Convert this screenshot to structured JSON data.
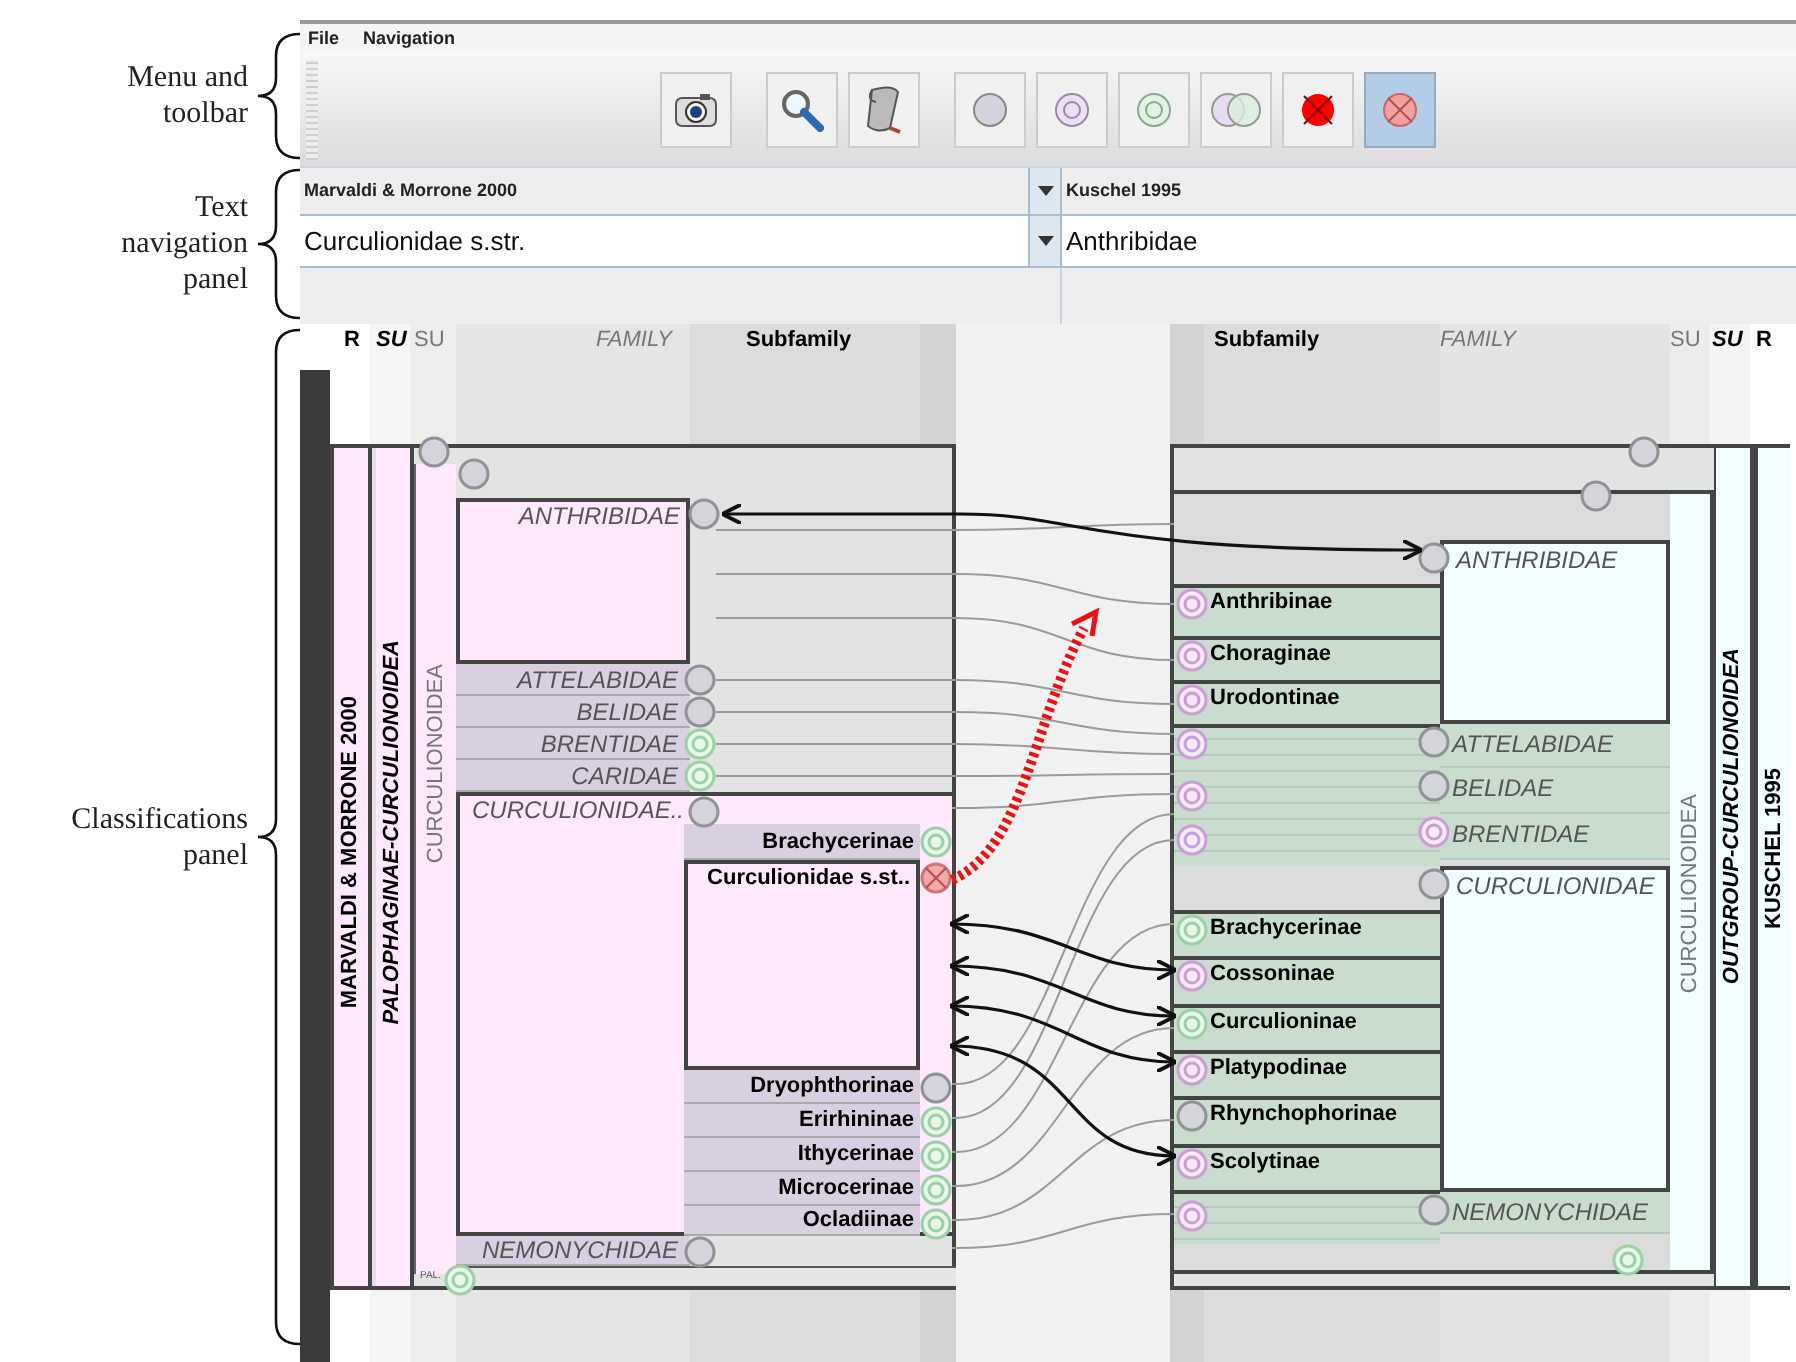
{
  "annotations": [
    {
      "lines": [
        "Menu and",
        "toolbar"
      ]
    },
    {
      "lines": [
        "Text",
        "navigation",
        "panel"
      ]
    },
    {
      "lines": [
        "Classifications",
        "panel"
      ]
    }
  ],
  "menu": [
    "File",
    "Navigation"
  ],
  "toolbar": [
    {
      "kind": "camera",
      "selected": false
    },
    {
      "kind": "magnifier",
      "selected": false
    },
    {
      "kind": "scroll",
      "selected": false
    },
    {
      "kind": "circle",
      "selected": false
    },
    {
      "kind": "lilac-ring",
      "selected": false
    },
    {
      "kind": "mint-ring",
      "selected": false
    },
    {
      "kind": "overlap",
      "selected": false
    },
    {
      "kind": "red-cross",
      "selected": false
    },
    {
      "kind": "pink-cross",
      "selected": true
    }
  ],
  "text_navigation": {
    "left": {
      "classification": "Marvaldi & Morrone 2000",
      "taxon": "Curculionidae s.str."
    },
    "right": {
      "classification": "Kuschel 1995",
      "taxon": "Anthribidae"
    }
  },
  "classifications": {
    "header_left": [
      {
        "text": "R",
        "kind": "bold"
      },
      {
        "text": "SU",
        "kind": "emphasis"
      },
      {
        "text": "SU",
        "kind": "plain"
      },
      {
        "text": "FAMILY",
        "kind": "italic"
      },
      {
        "text": "Subfamily",
        "kind": "bold"
      }
    ],
    "header_right": [
      {
        "text": "Subfamily",
        "kind": "bold"
      },
      {
        "text": "FAMILY",
        "kind": "italic"
      },
      {
        "text": "SU",
        "kind": "plain"
      },
      {
        "text": "SU",
        "kind": "emphasis"
      },
      {
        "text": "R",
        "kind": "bold"
      }
    ],
    "left": {
      "title": "MARVALDI & MORRONE 2000",
      "superorder": "PALOPHAGINAE-CURCULIONOIDEA",
      "superfamily": "CURCULIONOIDEA",
      "footer": "PAL.",
      "families": [
        {
          "name": "ANTHRIBIDAE",
          "kind": "plain",
          "expanded": true
        },
        {
          "name": "ATTELABIDAE",
          "kind": "plain",
          "expanded": false
        },
        {
          "name": "BELIDAE",
          "kind": "plain",
          "expanded": false
        },
        {
          "name": "BRENTIDAE",
          "kind": "mint",
          "expanded": false
        },
        {
          "name": "CARIDAE",
          "kind": "mint",
          "expanded": false
        },
        {
          "name": "CURCULIONIDAE..",
          "kind": "plain",
          "expanded": true,
          "children": [
            {
              "name": "Brachycerinae",
              "kind": "mint",
              "expanded": false
            },
            {
              "name": "Curculionidae s.st..",
              "kind": "cross",
              "expanded": true
            },
            {
              "name": "Dryophthorinae",
              "kind": "plain",
              "expanded": false
            },
            {
              "name": "Erirhininae",
              "kind": "mint",
              "expanded": false
            },
            {
              "name": "Ithycerinae",
              "kind": "mint",
              "expanded": false
            },
            {
              "name": "Microcerinae",
              "kind": "mint",
              "expanded": false
            },
            {
              "name": "Ocladiinae",
              "kind": "mint",
              "expanded": false
            }
          ]
        },
        {
          "name": "NEMONYCHIDAE",
          "kind": "plain",
          "expanded": false
        }
      ]
    },
    "right": {
      "title": "KUSCHEL 1995",
      "superorder": "OUTGROUP-CURCULIONOIDEA",
      "superfamily": "CURCULIONOIDEA",
      "families": [
        {
          "name": "ANTHRIBIDAE",
          "kind": "plain",
          "expanded": true,
          "children": [
            {
              "name": "Anthribinae",
              "kind": "lilac"
            },
            {
              "name": "Choraginae",
              "kind": "lilac"
            },
            {
              "name": "Urodontinae",
              "kind": "lilac"
            }
          ]
        },
        {
          "name": "ATTELABIDAE",
          "kind": "plain",
          "expanded": false
        },
        {
          "name": "BELIDAE",
          "kind": "plain",
          "expanded": false
        },
        {
          "name": "BRENTIDAE",
          "kind": "lilac",
          "expanded": false
        },
        {
          "name": "CURCULIONIDAE",
          "kind": "plain",
          "expanded": true,
          "children": [
            {
              "name": "Brachycerinae",
              "kind": "mint"
            },
            {
              "name": "Cossoninae",
              "kind": "lilac"
            },
            {
              "name": "Curculioninae",
              "kind": "mint"
            },
            {
              "name": "Platypodinae",
              "kind": "lilac"
            },
            {
              "name": "Rhynchophorinae",
              "kind": "plain"
            },
            {
              "name": "Scolytinae",
              "kind": "lilac"
            }
          ]
        },
        {
          "name": "NEMONYCHIDAE",
          "kind": "plain",
          "expanded": false
        }
      ]
    }
  }
}
